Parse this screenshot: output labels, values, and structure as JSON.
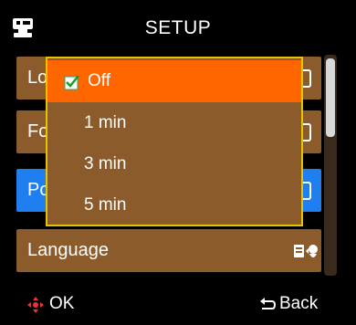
{
  "header": {
    "title": "SETUP",
    "icon": "camera-setup-icon"
  },
  "list": {
    "items": [
      {
        "label": "Lo",
        "value_icon": "value-icon"
      },
      {
        "label": "Fo",
        "value_icon": "value-icon"
      },
      {
        "label": "Po",
        "value_icon": "value-icon",
        "highlighted": true
      },
      {
        "label": "Language",
        "value_icon": "language-icon"
      }
    ],
    "scroll_position": 0.0
  },
  "dropdown": {
    "options": [
      {
        "label": "Off",
        "selected": true
      },
      {
        "label": "1 min"
      },
      {
        "label": "3 min"
      },
      {
        "label": "5 min"
      }
    ]
  },
  "footer": {
    "ok_label": "OK",
    "back_label": "Back",
    "ok_icon": "dpad-icon",
    "back_icon": "back-arrow-icon"
  },
  "colors": {
    "row": "#8b5b2c",
    "row_highlight": "#1f7ef0",
    "selected": "#ff6600",
    "dropdown_border": "#e7c400"
  }
}
